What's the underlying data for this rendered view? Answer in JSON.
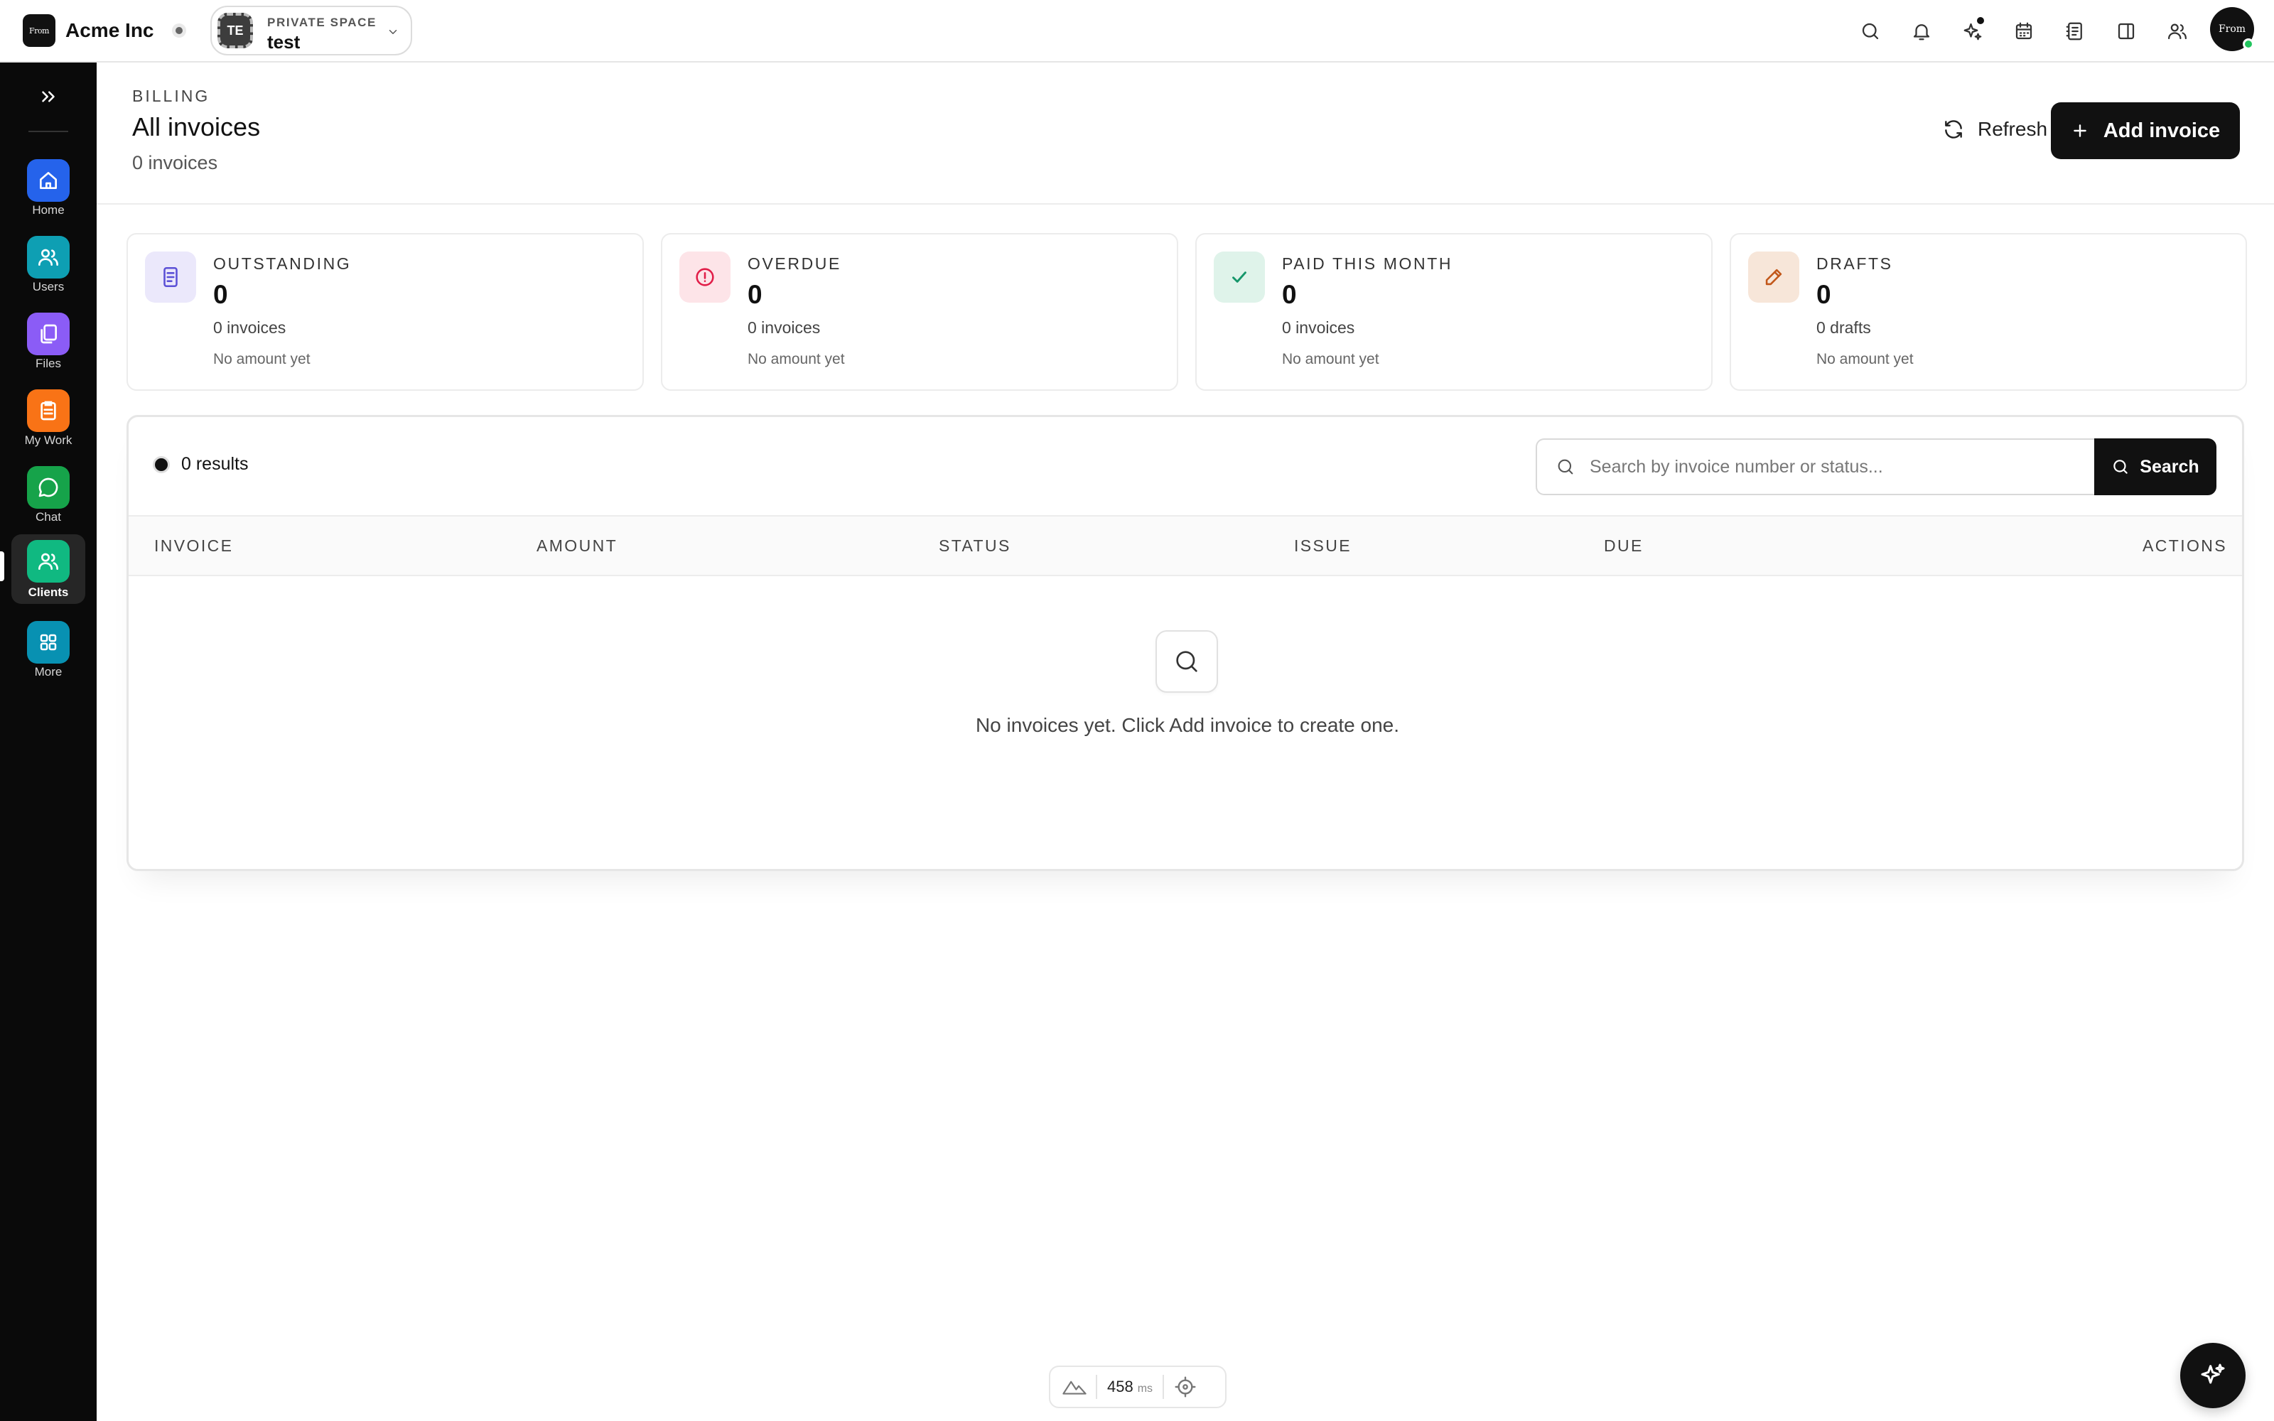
{
  "topbar": {
    "org_logo": "From",
    "org_name": "Acme Inc",
    "space": {
      "initials": "TE",
      "kicker": "PRIVATE SPACE",
      "name": "test"
    },
    "icons": [
      "search-icon",
      "bell-icon",
      "sparkle-icon",
      "calendar-icon",
      "notes-icon",
      "panel-icon",
      "people-icon"
    ],
    "user_avatar": "From"
  },
  "sidebar": {
    "items": [
      {
        "label": "Home",
        "icon": "home-icon",
        "color": "#2563eb"
      },
      {
        "label": "Users",
        "icon": "users-icon",
        "color": "#0e9fb3"
      },
      {
        "label": "Files",
        "icon": "files-icon",
        "color": "#8b5cf6"
      },
      {
        "label": "My Work",
        "icon": "clipboard-icon",
        "color": "#f97316"
      },
      {
        "label": "Chat",
        "icon": "chat-icon",
        "color": "#16a34a"
      },
      {
        "label": "Clients",
        "icon": "clients-icon",
        "color": "#10b981",
        "active": true
      },
      {
        "label": "More",
        "icon": "grid-icon",
        "color": "#0891b2"
      }
    ]
  },
  "header": {
    "kicker": "BILLING",
    "title": "All invoices",
    "subtitle": "0 invoices",
    "refresh_label": "Refresh",
    "add_label": "Add invoice"
  },
  "stats": [
    {
      "label": "OUTSTANDING",
      "value": "0",
      "count": "0 invoices",
      "note": "No amount yet",
      "icon": "document-icon",
      "tint": "#ebe8fb",
      "color": "#5b50d6"
    },
    {
      "label": "OVERDUE",
      "value": "0",
      "count": "0 invoices",
      "note": "No amount yet",
      "icon": "alert-icon",
      "tint": "#fde4e8",
      "color": "#e11d48"
    },
    {
      "label": "PAID THIS MONTH",
      "value": "0",
      "count": "0 invoices",
      "note": "No amount yet",
      "icon": "check-icon",
      "tint": "#dff3ea",
      "color": "#15966a"
    },
    {
      "label": "DRAFTS",
      "value": "0",
      "count": "0 drafts",
      "note": "No amount yet",
      "icon": "pencil-icon",
      "tint": "#f7e6d9",
      "color": "#c2571a"
    }
  ],
  "table": {
    "results": "0 results",
    "search_placeholder": "Search by invoice number or status...",
    "search_label": "Search",
    "columns": [
      "INVOICE",
      "AMOUNT",
      "STATUS",
      "ISSUE",
      "DUE",
      "ACTIONS"
    ],
    "empty_text": "No invoices yet. Click Add invoice to create one."
  },
  "perf": {
    "value": "458",
    "unit": "ms"
  }
}
